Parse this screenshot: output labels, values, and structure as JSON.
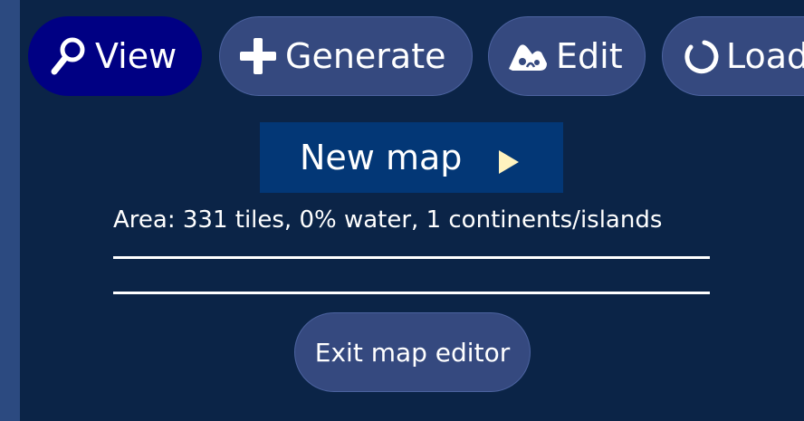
{
  "tabs": [
    {
      "label": "View",
      "icon": "magnifier-icon",
      "active": true
    },
    {
      "label": "Generate",
      "icon": "plus-icon",
      "active": false
    },
    {
      "label": "Edit",
      "icon": "terrain-edit-icon",
      "active": false
    },
    {
      "label": "Load",
      "icon": "load-spinner-icon",
      "active": false
    }
  ],
  "generate_panel": {
    "new_map_label": "New map",
    "area_info": "Area: 331 tiles, 0% water, 1 continents/islands"
  },
  "footer": {
    "exit_label": "Exit map editor"
  },
  "colors": {
    "background": "#0b2447",
    "tab": "#35497f",
    "tab_active": "#000083",
    "new_map_button": "#033776",
    "arrow": "#fff3bf"
  }
}
